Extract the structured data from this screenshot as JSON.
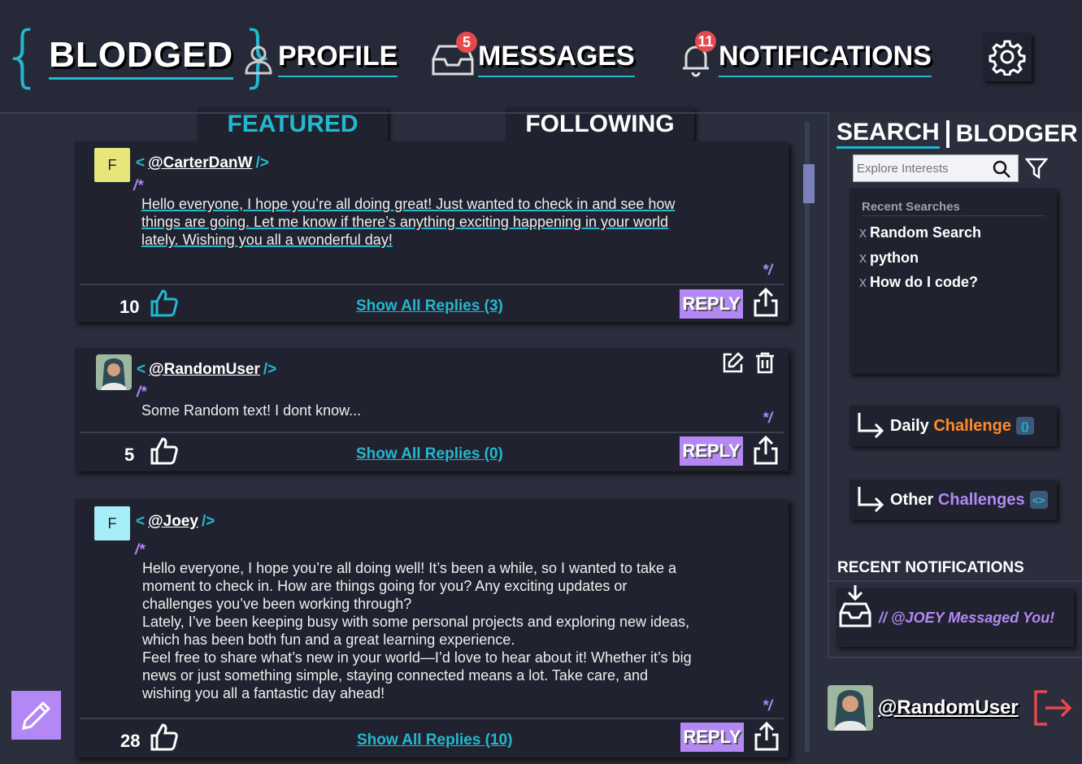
{
  "app": {
    "logo": "BLODGED",
    "brace_open": "{",
    "brace_close": "}"
  },
  "nav": {
    "profile": "PROFILE",
    "messages": "MESSAGES",
    "messages_badge": "5",
    "notifications": "NOTIFICATIONS",
    "notifications_badge": "11"
  },
  "tabs": {
    "featured": "FEATURED",
    "following": "FOLLOWING"
  },
  "posts": [
    {
      "avatar_letter": "F",
      "avatar_color": "#e6e67a",
      "tag_open": "<",
      "handle": "@CarterDanW",
      "tag_close": "/>",
      "comment_open": "/*",
      "comment_close": "*/",
      "lines": [
        "Hello everyone, I hope you’re all doing great! Just wanted to check in and see how",
        "things are going. Let me know if there’s anything exciting happening in your world",
        "lately. Wishing you all a wonderful day!"
      ],
      "likes": "10",
      "replies": "Show All Replies (3)",
      "reply": "REPLY"
    },
    {
      "tag_open": "<",
      "handle": "@RandomUser",
      "tag_close": "/>",
      "comment_open": "/*",
      "comment_close": "*/",
      "lines": [
        "Some Random text! I dont know..."
      ],
      "likes": "5",
      "replies": "Show All Replies (0)",
      "reply": "REPLY"
    },
    {
      "avatar_letter": "F",
      "avatar_color": "#a6eef7",
      "tag_open": "<",
      "handle": "@Joey",
      "tag_close": "/>",
      "comment_open": "/*",
      "comment_close": "*/",
      "lines": [
        "Hello everyone, I hope you’re all doing well! It’s been a while, so I wanted to take a",
        "moment to check in. How are things going for you? Any exciting updates or",
        "challenges you’ve been working through?",
        "Lately, I’ve been keeping busy with some personal projects and exploring new ideas,",
        "which has been both fun and a great learning experience.",
        "Feel free to share what’s new in your world—I’d love to hear about it! Whether it’s big",
        "news or just something simple, staying connected means a lot. Take care, and",
        "wishing you all a fantastic day ahead!"
      ],
      "likes": "28",
      "replies": "Show All Replies (10)",
      "reply": "REPLY"
    }
  ],
  "sidebar": {
    "search_title_1": "SEARCH",
    "search_title_2": "BLODGER",
    "search_placeholder": "Explore Interests",
    "recent_header": "Recent Searches",
    "recent": [
      {
        "x": "x",
        "text": "Random Search"
      },
      {
        "x": "x",
        "text": "python"
      },
      {
        "x": "x",
        "text": "How do I code?"
      }
    ],
    "daily_1": "Daily ",
    "daily_2": "Challenge",
    "daily_chip": "{}",
    "other_1": "Other ",
    "other_2": "Challenges",
    "other_chip": "<>",
    "notif_title": "RECENT NOTIFICATIONS",
    "notif_item": "// @JOEY Messaged You!",
    "current_user": "@RandomUser"
  },
  "colors": {
    "accent": "#22b8cf",
    "purple": "#b388f5",
    "orange": "#ff8a2a",
    "logout": "#e5484d"
  }
}
